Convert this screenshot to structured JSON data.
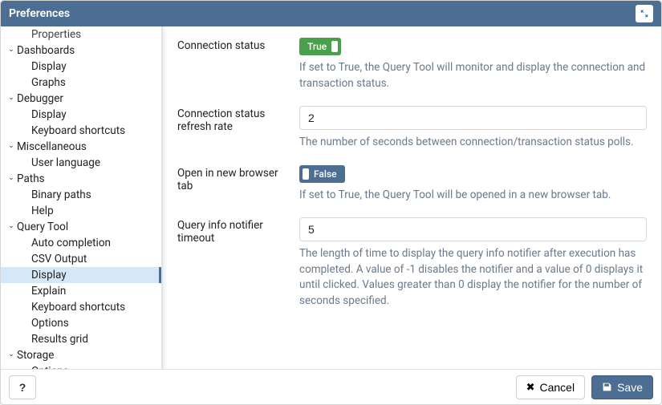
{
  "title": "Preferences",
  "tree": [
    {
      "truncatedVisibleChild": "Properties"
    },
    {
      "label": "Dashboards",
      "expanded": true,
      "children": [
        "Display",
        "Graphs"
      ]
    },
    {
      "label": "Debugger",
      "expanded": true,
      "children": [
        "Display",
        "Keyboard shortcuts"
      ]
    },
    {
      "label": "Miscellaneous",
      "expanded": true,
      "children": [
        "User language"
      ]
    },
    {
      "label": "Paths",
      "expanded": true,
      "children": [
        "Binary paths",
        "Help"
      ]
    },
    {
      "label": "Query Tool",
      "expanded": true,
      "children": [
        "Auto completion",
        "CSV Output",
        "Display",
        "Explain",
        "Keyboard shortcuts",
        "Options",
        "Results grid"
      ],
      "selectedChild": "Display"
    },
    {
      "label": "Storage",
      "expanded": true,
      "children": [
        "Options"
      ]
    }
  ],
  "form": {
    "connection_status": {
      "label": "Connection status",
      "value": true,
      "toggle_text_true": "True",
      "help": "If set to True, the Query Tool will monitor and display the connection and transaction status."
    },
    "refresh_rate": {
      "label": "Connection status refresh rate",
      "value": "2",
      "help": "The number of seconds between connection/transaction status polls."
    },
    "new_tab": {
      "label": "Open in new browser tab",
      "value": false,
      "toggle_text_false": "False",
      "help": "If set to True, the Query Tool will be opened in a new browser tab."
    },
    "notifier_timeout": {
      "label": "Query info notifier timeout",
      "value": "5",
      "help": "The length of time to display the query info notifier after execution has completed. A value of -1 disables the notifier and a value of 0 displays it until clicked. Values greater than 0 display the notifier for the number of seconds specified."
    }
  },
  "footer": {
    "help": "?",
    "cancel": "Cancel",
    "save": "Save"
  }
}
